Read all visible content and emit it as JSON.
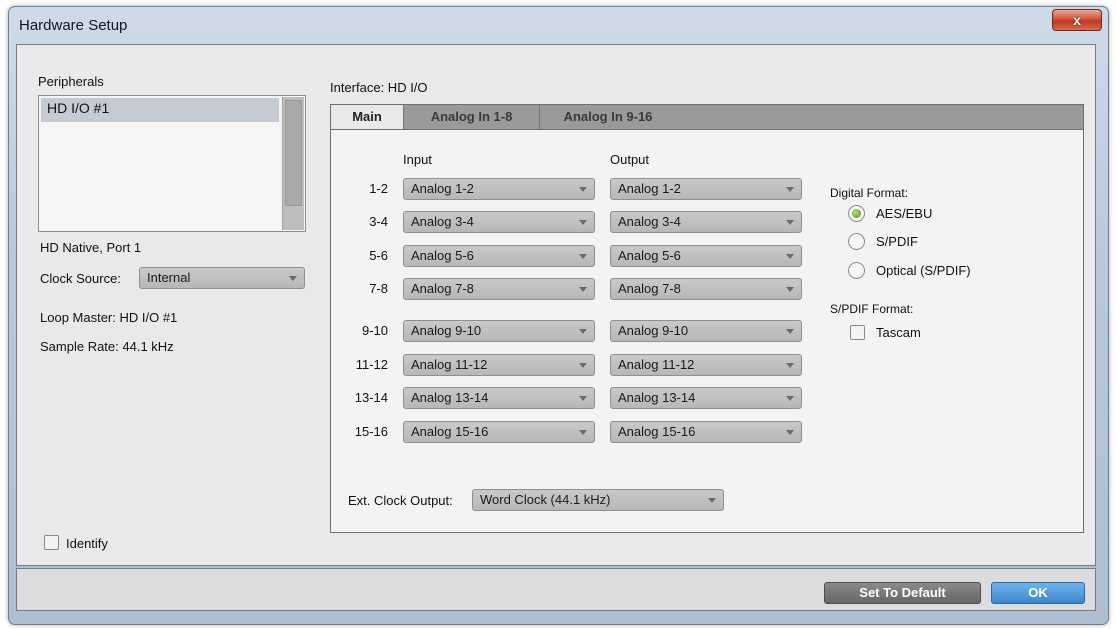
{
  "window": {
    "title": "Hardware Setup",
    "close_glyph": "x"
  },
  "left": {
    "peripherals_label": "Peripherals",
    "peripherals_items": [
      "HD I/O #1"
    ],
    "port_label": "HD Native, Port 1",
    "clock_source_label": "Clock Source:",
    "clock_source_value": "Internal",
    "loop_master": "Loop Master: HD I/O #1",
    "sample_rate": "Sample Rate:  44.1 kHz",
    "identify_label": "Identify"
  },
  "interface": {
    "label": "Interface: HD I/O",
    "tabs": [
      "Main",
      "Analog In 1-8",
      "Analog In 9-16"
    ],
    "input_head": "Input",
    "output_head": "Output",
    "rows": [
      {
        "label": "1-2",
        "input": "Analog 1-2",
        "output": "Analog 1-2"
      },
      {
        "label": "3-4",
        "input": "Analog 3-4",
        "output": "Analog 3-4"
      },
      {
        "label": "5-6",
        "input": "Analog 5-6",
        "output": "Analog 5-6"
      },
      {
        "label": "7-8",
        "input": "Analog 7-8",
        "output": "Analog 7-8"
      },
      {
        "label": "9-10",
        "input": "Analog 9-10",
        "output": "Analog 9-10"
      },
      {
        "label": "11-12",
        "input": "Analog 11-12",
        "output": "Analog 11-12"
      },
      {
        "label": "13-14",
        "input": "Analog 13-14",
        "output": "Analog 13-14"
      },
      {
        "label": "15-16",
        "input": "Analog 15-16",
        "output": "Analog 15-16"
      }
    ],
    "ext_clock_label": "Ext. Clock Output:",
    "ext_clock_value": "Word Clock (44.1 kHz)",
    "digital_format_head": "Digital Format:",
    "digital_formats": [
      "AES/EBU",
      "S/PDIF",
      "Optical (S/PDIF)"
    ],
    "digital_format_selected": "AES/EBU",
    "spdif_format_head": "S/PDIF Format:",
    "tascam_label": "Tascam"
  },
  "footer": {
    "default_label": "Set To Default",
    "ok_label": "OK"
  }
}
